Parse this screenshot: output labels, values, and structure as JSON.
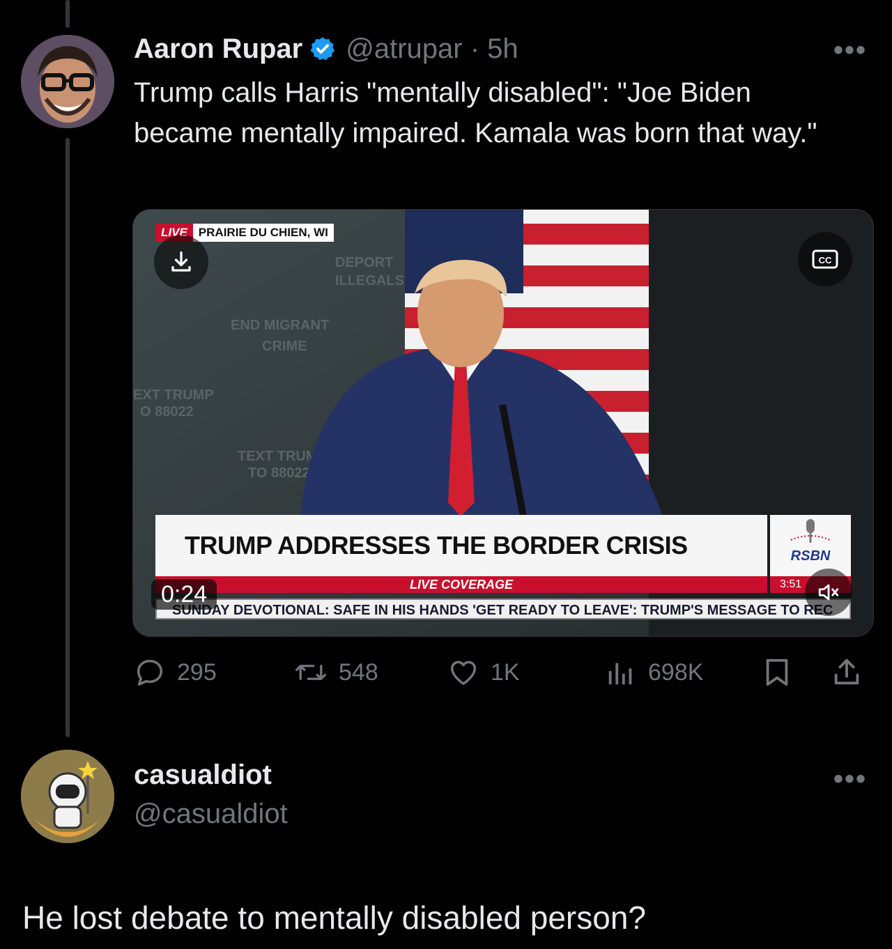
{
  "tweet": {
    "author_name": "Aaron Rupar",
    "handle_time": "@atrupar · 5h",
    "more_label": "•••",
    "text": "Trump calls Harris \"mentally disabled\": \"Joe Biden became mentally impaired. Kamala was born that way.\"",
    "video": {
      "live_label": "LIVE",
      "location": "PRAIRIE DU CHIEN, WI",
      "headline": "TRUMP ADDRESSES THE BORDER CRISIS",
      "subline": "LIVE COVERAGE",
      "ticker": "SUNDAY DEVOTIONAL: SAFE IN HIS HANDS     'GET READY TO LEAVE': TRUMP'S MESSAGE TO REC",
      "network": "RSBN",
      "clock": "3:51",
      "elapsed": "0:24",
      "cc_label": "CC"
    },
    "actions": {
      "replies": "295",
      "reposts": "548",
      "likes": "1K",
      "views": "698K"
    }
  },
  "reply": {
    "author_name": "casualdiot",
    "handle": "@casualdiot",
    "more_label": "•••",
    "text": "He lost debate to mentally disabled person?"
  },
  "colors": {
    "background": "#000000",
    "text_primary": "#e7e9ea",
    "text_secondary": "#71767b",
    "verified": "#1d9bf0",
    "chyron_red": "#c8102e"
  }
}
